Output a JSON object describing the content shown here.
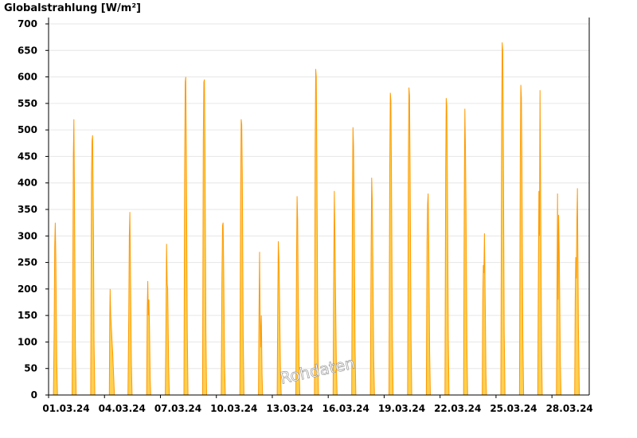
{
  "chart_data": {
    "type": "area",
    "ylabel": "Globalstrahlung [W/m²]",
    "ylim": [
      0,
      700
    ],
    "yticks": [
      0,
      50,
      100,
      150,
      200,
      250,
      300,
      350,
      400,
      450,
      500,
      550,
      600,
      650,
      700
    ],
    "xlim": [
      0,
      29
    ],
    "xtick_labels": [
      "01.03.24",
      "04.03.24",
      "07.03.24",
      "10.03.24",
      "13.03.24",
      "16.03.24",
      "19.03.24",
      "22.03.24",
      "25.03.24",
      "28.03.24"
    ],
    "grid": true,
    "fill_color": "#ffd050",
    "line_color": "#ff9a00",
    "watermark": "Rohdaten",
    "series": [
      {
        "values": [
          [
            0.0,
            0
          ],
          [
            0.26,
            0
          ],
          [
            0.3,
            120
          ],
          [
            0.33,
            280
          ],
          [
            0.36,
            325
          ],
          [
            0.39,
            260
          ],
          [
            0.44,
            60
          ],
          [
            0.48,
            0
          ],
          [
            1.26,
            0
          ],
          [
            1.3,
            200
          ],
          [
            1.33,
            450
          ],
          [
            1.36,
            520
          ],
          [
            1.39,
            380
          ],
          [
            1.44,
            90
          ],
          [
            1.48,
            0
          ],
          [
            2.26,
            0
          ],
          [
            2.3,
            420
          ],
          [
            2.33,
            480
          ],
          [
            2.36,
            490
          ],
          [
            2.38,
            420
          ],
          [
            2.41,
            300
          ],
          [
            2.44,
            100
          ],
          [
            2.48,
            0
          ],
          [
            3.26,
            0
          ],
          [
            3.28,
            140
          ],
          [
            3.3,
            200
          ],
          [
            3.33,
            150
          ],
          [
            3.38,
            120
          ],
          [
            3.44,
            80
          ],
          [
            3.5,
            30
          ],
          [
            3.53,
            0
          ],
          [
            4.26,
            0
          ],
          [
            4.3,
            150
          ],
          [
            4.33,
            300
          ],
          [
            4.36,
            345
          ],
          [
            4.39,
            240
          ],
          [
            4.44,
            60
          ],
          [
            4.48,
            0
          ],
          [
            5.26,
            0
          ],
          [
            5.29,
            160
          ],
          [
            5.32,
            215
          ],
          [
            5.35,
            150
          ],
          [
            5.38,
            180
          ],
          [
            5.41,
            130
          ],
          [
            5.45,
            30
          ],
          [
            5.48,
            0
          ],
          [
            6.26,
            0
          ],
          [
            6.3,
            150
          ],
          [
            6.33,
            285
          ],
          [
            6.36,
            210
          ],
          [
            6.39,
            200
          ],
          [
            6.44,
            50
          ],
          [
            6.48,
            0
          ],
          [
            7.26,
            0
          ],
          [
            7.3,
            420
          ],
          [
            7.33,
            590
          ],
          [
            7.36,
            600
          ],
          [
            7.39,
            460
          ],
          [
            7.44,
            120
          ],
          [
            7.48,
            0
          ],
          [
            8.26,
            0
          ],
          [
            8.3,
            480
          ],
          [
            8.33,
            590
          ],
          [
            8.36,
            595
          ],
          [
            8.39,
            470
          ],
          [
            8.44,
            120
          ],
          [
            8.48,
            0
          ],
          [
            9.26,
            0
          ],
          [
            9.3,
            220
          ],
          [
            9.33,
            320
          ],
          [
            9.36,
            325
          ],
          [
            9.39,
            240
          ],
          [
            9.44,
            60
          ],
          [
            9.48,
            0
          ],
          [
            10.26,
            0
          ],
          [
            10.3,
            380
          ],
          [
            10.33,
            520
          ],
          [
            10.36,
            510
          ],
          [
            10.39,
            420
          ],
          [
            10.44,
            110
          ],
          [
            10.48,
            0
          ],
          [
            11.26,
            0
          ],
          [
            11.29,
            160
          ],
          [
            11.32,
            270
          ],
          [
            11.35,
            150
          ],
          [
            11.38,
            90
          ],
          [
            11.41,
            150
          ],
          [
            11.45,
            40
          ],
          [
            11.48,
            0
          ],
          [
            12.26,
            0
          ],
          [
            12.29,
            170
          ],
          [
            12.32,
            290
          ],
          [
            12.35,
            260
          ],
          [
            12.38,
            200
          ],
          [
            12.44,
            40
          ],
          [
            12.48,
            0
          ],
          [
            13.26,
            0
          ],
          [
            13.3,
            250
          ],
          [
            13.33,
            375
          ],
          [
            13.36,
            330
          ],
          [
            13.39,
            200
          ],
          [
            13.44,
            50
          ],
          [
            13.48,
            0
          ],
          [
            14.26,
            0
          ],
          [
            14.3,
            470
          ],
          [
            14.33,
            615
          ],
          [
            14.36,
            600
          ],
          [
            14.39,
            450
          ],
          [
            14.44,
            110
          ],
          [
            14.48,
            0
          ],
          [
            15.26,
            0
          ],
          [
            15.3,
            250
          ],
          [
            15.33,
            385
          ],
          [
            15.36,
            300
          ],
          [
            15.39,
            200
          ],
          [
            15.44,
            50
          ],
          [
            15.48,
            0
          ],
          [
            16.26,
            0
          ],
          [
            16.3,
            380
          ],
          [
            16.33,
            505
          ],
          [
            16.36,
            470
          ],
          [
            16.39,
            350
          ],
          [
            16.44,
            90
          ],
          [
            16.48,
            0
          ],
          [
            17.26,
            0
          ],
          [
            17.3,
            280
          ],
          [
            17.33,
            410
          ],
          [
            17.36,
            370
          ],
          [
            17.39,
            260
          ],
          [
            17.44,
            70
          ],
          [
            17.48,
            0
          ],
          [
            18.26,
            0
          ],
          [
            18.3,
            430
          ],
          [
            18.33,
            570
          ],
          [
            18.36,
            555
          ],
          [
            18.39,
            420
          ],
          [
            18.44,
            110
          ],
          [
            18.48,
            0
          ],
          [
            19.26,
            0
          ],
          [
            19.3,
            440
          ],
          [
            19.33,
            580
          ],
          [
            19.36,
            565
          ],
          [
            19.39,
            430
          ],
          [
            19.44,
            110
          ],
          [
            19.48,
            0
          ],
          [
            20.26,
            0
          ],
          [
            20.3,
            290
          ],
          [
            20.33,
            360
          ],
          [
            20.36,
            380
          ],
          [
            20.39,
            300
          ],
          [
            20.44,
            80
          ],
          [
            20.48,
            0
          ],
          [
            21.26,
            0
          ],
          [
            21.3,
            430
          ],
          [
            21.33,
            560
          ],
          [
            21.36,
            545
          ],
          [
            21.39,
            420
          ],
          [
            21.44,
            110
          ],
          [
            21.48,
            0
          ],
          [
            22.26,
            0
          ],
          [
            22.3,
            380
          ],
          [
            22.33,
            540
          ],
          [
            22.36,
            470
          ],
          [
            22.39,
            360
          ],
          [
            22.44,
            90
          ],
          [
            22.48,
            0
          ],
          [
            23.26,
            0
          ],
          [
            23.29,
            180
          ],
          [
            23.32,
            245
          ],
          [
            23.35,
            230
          ],
          [
            23.38,
            305
          ],
          [
            23.42,
            170
          ],
          [
            23.46,
            40
          ],
          [
            23.49,
            0
          ],
          [
            24.26,
            0
          ],
          [
            24.3,
            520
          ],
          [
            24.33,
            665
          ],
          [
            24.36,
            650
          ],
          [
            24.39,
            480
          ],
          [
            24.44,
            120
          ],
          [
            24.48,
            0
          ],
          [
            25.26,
            0
          ],
          [
            25.3,
            450
          ],
          [
            25.33,
            585
          ],
          [
            25.36,
            560
          ],
          [
            25.39,
            440
          ],
          [
            25.44,
            110
          ],
          [
            25.48,
            0
          ],
          [
            26.24,
            0
          ],
          [
            26.27,
            220
          ],
          [
            26.3,
            385
          ],
          [
            26.33,
            300
          ],
          [
            26.36,
            575
          ],
          [
            26.39,
            400
          ],
          [
            26.44,
            100
          ],
          [
            26.48,
            0
          ],
          [
            27.24,
            0
          ],
          [
            27.27,
            200
          ],
          [
            27.3,
            380
          ],
          [
            27.33,
            180
          ],
          [
            27.36,
            340
          ],
          [
            27.4,
            250
          ],
          [
            27.45,
            60
          ],
          [
            27.49,
            0
          ],
          [
            28.22,
            0
          ],
          [
            28.25,
            180
          ],
          [
            28.28,
            260
          ],
          [
            28.31,
            220
          ],
          [
            28.34,
            330
          ],
          [
            28.37,
            390
          ],
          [
            28.42,
            130
          ],
          [
            28.47,
            0
          ],
          [
            29.0,
            0
          ]
        ]
      }
    ]
  }
}
